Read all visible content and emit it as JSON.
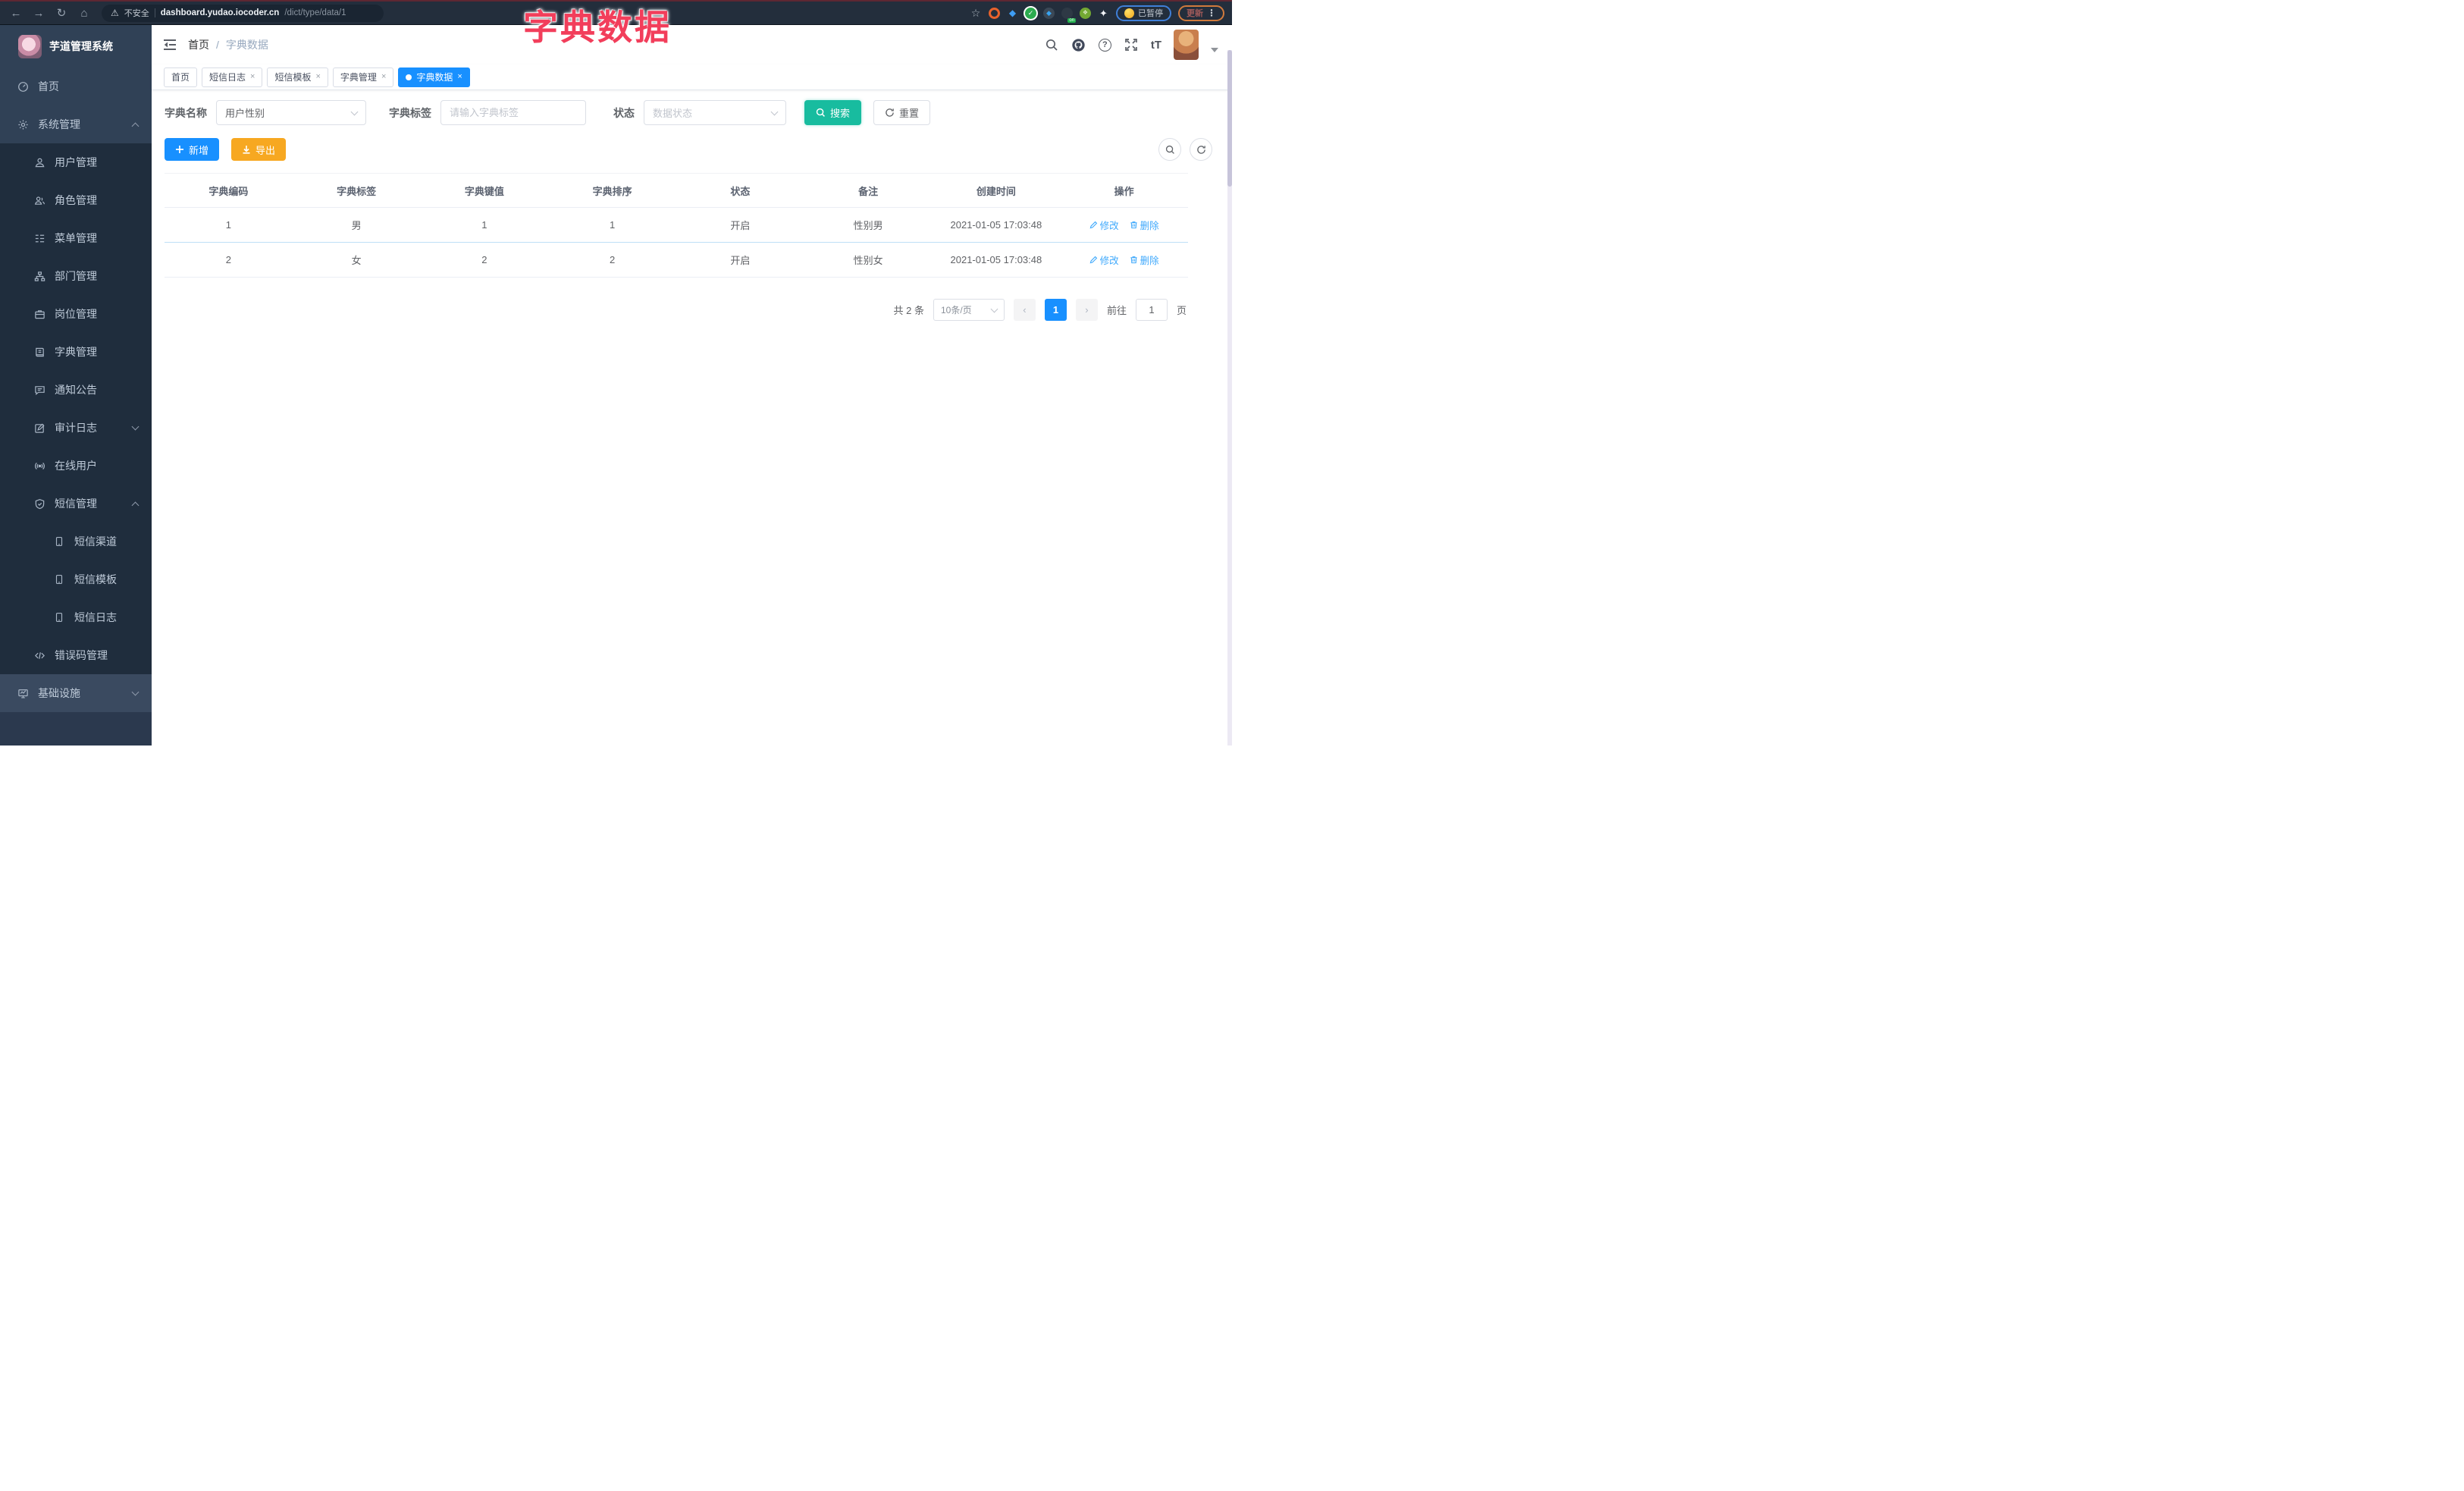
{
  "browser": {
    "security_label": "不安全",
    "url_host": "dashboard.yudao.iocoder.cn",
    "url_path": "/dict/type/data/1",
    "paused_badge": "已暂停",
    "update_button": "更新"
  },
  "overlay_title": "字典数据",
  "sidebar": {
    "app_title": "芋道管理系统",
    "items": [
      {
        "label": "首页"
      },
      {
        "label": "系统管理"
      },
      {
        "label": "用户管理"
      },
      {
        "label": "角色管理"
      },
      {
        "label": "菜单管理"
      },
      {
        "label": "部门管理"
      },
      {
        "label": "岗位管理"
      },
      {
        "label": "字典管理"
      },
      {
        "label": "通知公告"
      },
      {
        "label": "审计日志"
      },
      {
        "label": "在线用户"
      },
      {
        "label": "短信管理"
      },
      {
        "label": "短信渠道"
      },
      {
        "label": "短信模板"
      },
      {
        "label": "短信日志"
      },
      {
        "label": "错误码管理"
      },
      {
        "label": "基础设施"
      }
    ]
  },
  "breadcrumb": {
    "home": "首页",
    "separator": "/",
    "current": "字典数据"
  },
  "tabs": [
    {
      "label": "首页"
    },
    {
      "label": "短信日志"
    },
    {
      "label": "短信模板"
    },
    {
      "label": "字典管理"
    },
    {
      "label": "字典数据"
    }
  ],
  "filters": {
    "dict_name_label": "字典名称",
    "dict_name_value": "用户性别",
    "dict_label_label": "字典标签",
    "dict_label_placeholder": "请输入字典标签",
    "status_label": "状态",
    "status_placeholder": "数据状态",
    "search_button": "搜索",
    "reset_button": "重置"
  },
  "toolbar": {
    "add_button": "新增",
    "export_button": "导出"
  },
  "table": {
    "headers": [
      "字典编码",
      "字典标签",
      "字典键值",
      "字典排序",
      "状态",
      "备注",
      "创建时间",
      "操作"
    ],
    "rows": [
      {
        "code": "1",
        "label": "男",
        "value": "1",
        "sort": "1",
        "status": "开启",
        "remark": "性别男",
        "created": "2021-01-05 17:03:48",
        "edit": "修改",
        "delete": "删除"
      },
      {
        "code": "2",
        "label": "女",
        "value": "2",
        "sort": "2",
        "status": "开启",
        "remark": "性别女",
        "created": "2021-01-05 17:03:48",
        "edit": "修改",
        "delete": "删除"
      }
    ]
  },
  "pagination": {
    "total": "共 2 条",
    "page_size": "10条/页",
    "current_page": "1",
    "goto_label": "前往",
    "goto_value": "1",
    "page_unit": "页"
  },
  "colors": {
    "primary": "#1890ff",
    "search_teal": "#18bc9f",
    "export_orange": "#f7a821",
    "overlay_pink": "#f23e5b",
    "sidebar_bg": "#304156",
    "submenu_bg": "#1f2d3d"
  }
}
